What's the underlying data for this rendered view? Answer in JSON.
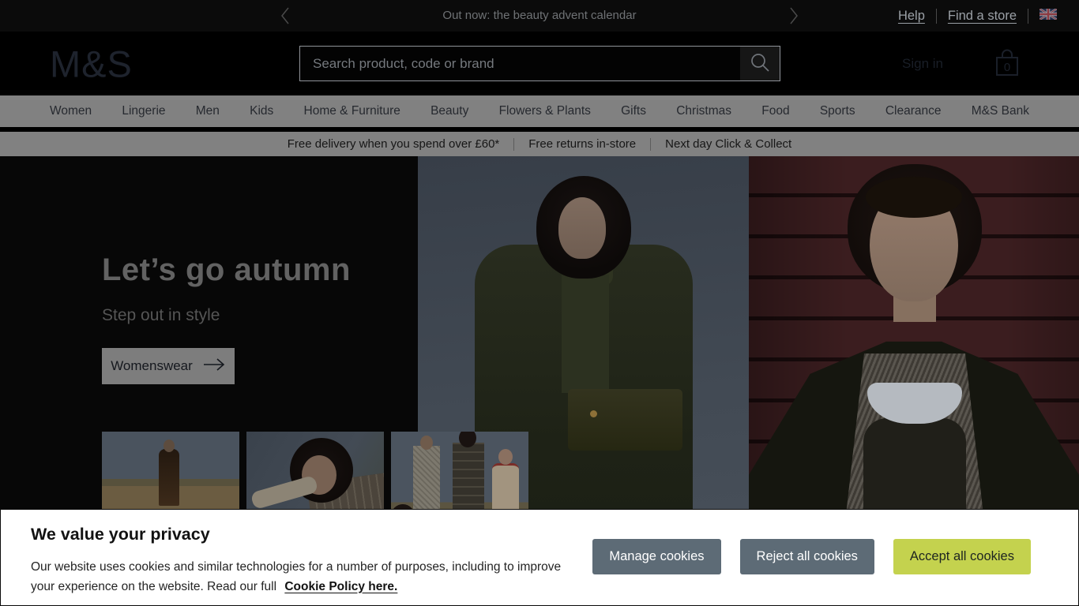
{
  "topbar": {
    "promo": "Out now: the beauty advent calendar",
    "help": "Help",
    "find_store": "Find a store"
  },
  "header": {
    "logo": "M&S",
    "search_placeholder": "Search product, code or brand",
    "sign_in": "Sign in",
    "basket_count": "0"
  },
  "nav": {
    "items": [
      "Women",
      "Lingerie",
      "Men",
      "Kids",
      "Home & Furniture",
      "Beauty",
      "Flowers & Plants",
      "Gifts",
      "Christmas",
      "Food",
      "Sports",
      "Clearance",
      "M&S Bank"
    ]
  },
  "benefits": {
    "items": [
      "Free delivery when you spend over £60*",
      "Free returns in-store",
      "Next day Click & Collect"
    ]
  },
  "hero": {
    "title": "Let’s go autumn",
    "subtitle": "Step out in style",
    "cta": "Womenswear"
  },
  "cookie_banner": {
    "title": "We value your privacy",
    "body": "Our website uses cookies and similar technologies for a number of purposes, including to improve your experience on the website. Read our full",
    "link": "Cookie Policy here.",
    "manage": "Manage cookies",
    "reject": "Reject all cookies",
    "accept": "Accept all cookies"
  },
  "icons": {
    "prev": "chevron-left",
    "next": "chevron-right",
    "locale": "uk-flag",
    "search": "magnifier",
    "basket": "shopping-bag",
    "cta_arrow": "arrow-right"
  },
  "colors": {
    "accept_green": "#c4d24e",
    "slate_button": "#5d6b76",
    "nav_bar_gray": "#818181",
    "page_background": "#000000",
    "banner_background": "#ffffff"
  }
}
